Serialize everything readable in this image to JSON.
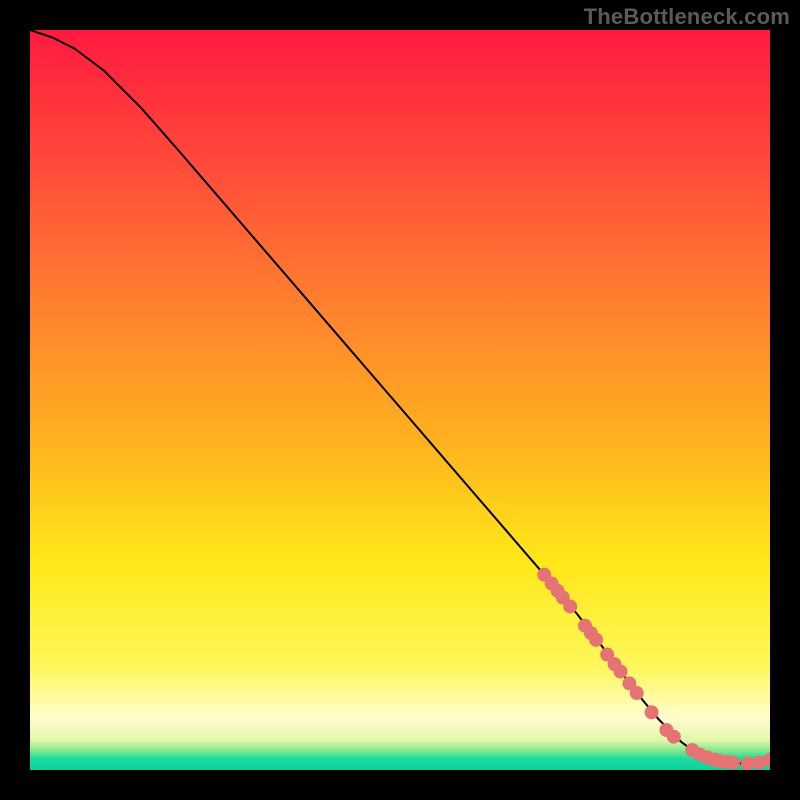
{
  "branding": {
    "watermark": "TheBottleneck.com"
  },
  "chart_data": {
    "type": "line",
    "title": "",
    "xlabel": "",
    "ylabel": "",
    "xlim": [
      0,
      100
    ],
    "ylim": [
      0,
      100
    ],
    "grid": false,
    "series": [
      {
        "name": "curve",
        "x": [
          0,
          3,
          6,
          10,
          15,
          20,
          25,
          30,
          35,
          40,
          45,
          50,
          55,
          60,
          65,
          70,
          74,
          78,
          82,
          85,
          88,
          90,
          92,
          94,
          96,
          98,
          100
        ],
        "y": [
          100,
          99,
          97.5,
          94.5,
          89.5,
          83.8,
          78,
          72.2,
          66.4,
          60.6,
          54.8,
          49,
          43.2,
          37.4,
          31.6,
          25.8,
          21,
          15.8,
          10.4,
          6.8,
          3.8,
          2.3,
          1.4,
          1.0,
          0.9,
          0.9,
          1.4
        ]
      }
    ],
    "markers": [
      {
        "x": 69.5,
        "y": 26.4
      },
      {
        "x": 70.5,
        "y": 25.2
      },
      {
        "x": 71.3,
        "y": 24.2
      },
      {
        "x": 72.0,
        "y": 23.3
      },
      {
        "x": 73.0,
        "y": 22.1
      },
      {
        "x": 75.0,
        "y": 19.5
      },
      {
        "x": 75.8,
        "y": 18.5
      },
      {
        "x": 76.5,
        "y": 17.6
      },
      {
        "x": 78.0,
        "y": 15.6
      },
      {
        "x": 79.0,
        "y": 14.3
      },
      {
        "x": 79.8,
        "y": 13.3
      },
      {
        "x": 81.0,
        "y": 11.7
      },
      {
        "x": 82.0,
        "y": 10.4
      },
      {
        "x": 84.0,
        "y": 7.8
      },
      {
        "x": 86.0,
        "y": 5.4
      },
      {
        "x": 87.0,
        "y": 4.5
      },
      {
        "x": 89.5,
        "y": 2.7
      },
      {
        "x": 90.5,
        "y": 2.1
      },
      {
        "x": 91.5,
        "y": 1.7
      },
      {
        "x": 92.5,
        "y": 1.4
      },
      {
        "x": 93.3,
        "y": 1.2
      },
      {
        "x": 94.2,
        "y": 1.1
      },
      {
        "x": 95.0,
        "y": 1.0
      },
      {
        "x": 97.0,
        "y": 0.9
      },
      {
        "x": 98.5,
        "y": 1.0
      },
      {
        "x": 100.0,
        "y": 1.4
      }
    ],
    "colors": {
      "curve_stroke": "#000000",
      "marker_fill": "#e67373",
      "gradient_top": "#ff1a3f",
      "gradient_bottom": "#0fd19b"
    }
  }
}
